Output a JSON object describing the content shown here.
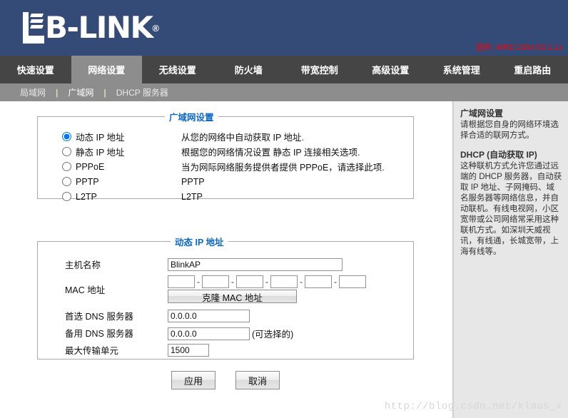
{
  "header": {
    "brand_text": "B-LINK",
    "brand_registered": "®",
    "firmware": "固件: WRD 2354.53.1.1z",
    "brand_bg": "#344a77",
    "firmware_color": "#ff0000"
  },
  "nav": {
    "items": [
      {
        "label": "快速设置",
        "active": false
      },
      {
        "label": "网络设置",
        "active": true
      },
      {
        "label": "无线设置",
        "active": false
      },
      {
        "label": "防火墙",
        "active": false
      },
      {
        "label": "带宽控制",
        "active": false
      },
      {
        "label": "高级设置",
        "active": false
      },
      {
        "label": "系统管理",
        "active": false
      },
      {
        "label": "重启路由",
        "active": false
      }
    ]
  },
  "subnav": {
    "items": [
      {
        "label": "局域网",
        "active": false
      },
      {
        "label": "广域网",
        "active": true
      },
      {
        "label": "DHCP 服务器",
        "active": false
      }
    ],
    "separator": "|"
  },
  "wan_panel": {
    "legend": "广域网设置",
    "legend_color": "#0b68c8",
    "options": [
      {
        "label": "动态 IP 地址",
        "desc": "从您的网络中自动获取 IP 地址.",
        "selected": true
      },
      {
        "label": "静态 IP 地址",
        "desc": "根据您的网络情况设置 静态 IP 连接相关选项.",
        "selected": false
      },
      {
        "label": "PPPoE",
        "desc": "当为网际网络服务提供者提供 PPPoE，请选择此项.",
        "selected": false
      },
      {
        "label": "PPTP",
        "desc": "PPTP",
        "selected": false
      },
      {
        "label": "L2TP",
        "desc": "L2TP",
        "selected": false
      }
    ]
  },
  "dyn_panel": {
    "legend": "动态 IP 地址",
    "host_label": "主机名称",
    "host_value": "BlinkAP",
    "host_placeholder": "",
    "mac_label": "MAC 地址",
    "mac_values": [
      "",
      "",
      "",
      "",
      "",
      ""
    ],
    "mac_separator": "-",
    "clone_mac_label": "克隆 MAC 地址",
    "dns1_label": "首选 DNS 服务器",
    "dns1_value": "0.0.0.0",
    "dns2_label": "备用 DNS 服务器",
    "dns2_value": "0.0.0.0",
    "dns2_note": "(可选择的)",
    "mtu_label": "最大传输单元",
    "mtu_value": "1500"
  },
  "actions": {
    "apply_label": "应用",
    "cancel_label": "取消"
  },
  "sidebar": {
    "section1_title": "广域网设置",
    "section1_body": "请根据您自身的网络环境选择合适的联网方式。",
    "section2_title": "DHCP (自动获取 IP)",
    "section2_body": "这种联机方式允许您通过远端的 DHCP 服务器，自动获取 IP 地址、子网掩码、域名服务器等网络信息，并自动联机。有线电视网，小区宽带或公司网络常采用这种联机方式。如深圳天威视讯，有线通，长城宽带，上海有线等。"
  },
  "watermark": {
    "text": "http://blog.csdn.net/klaus_x"
  }
}
